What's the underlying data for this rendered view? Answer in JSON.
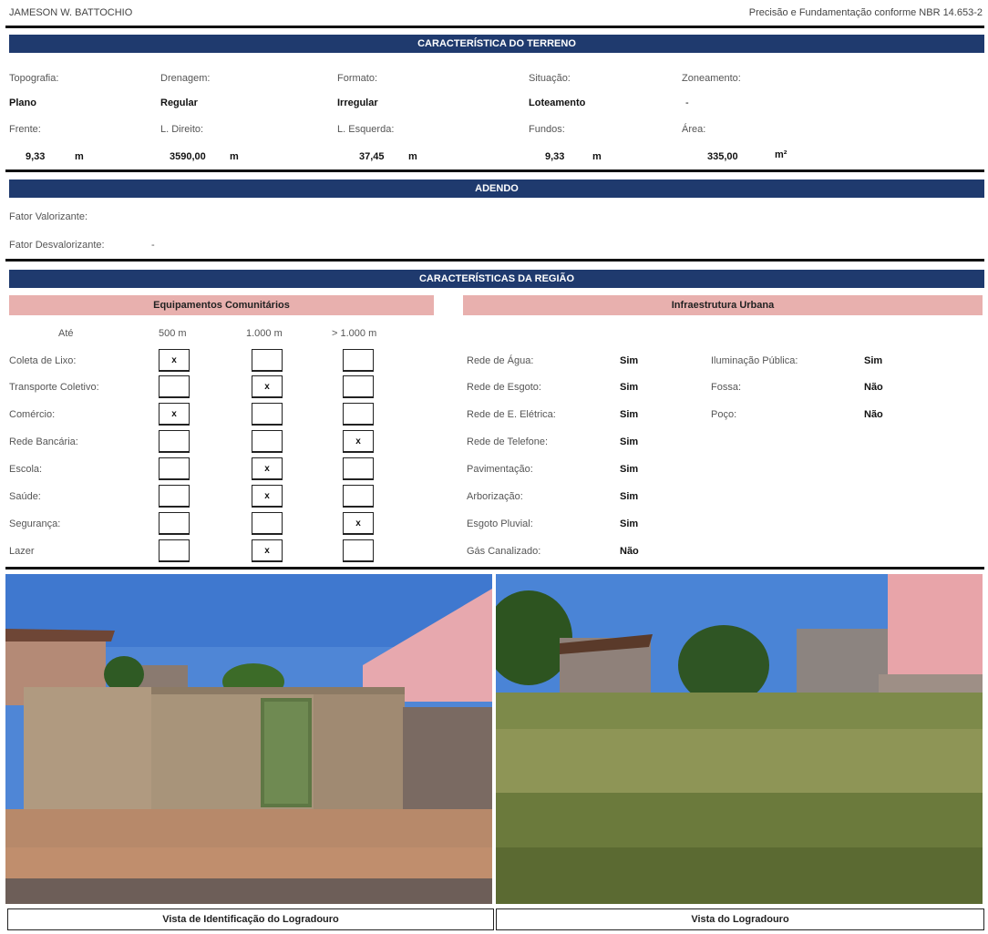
{
  "header": {
    "author": "JAMESON W. BATTOCHIO",
    "norm": "Precisão e Fundamentação conforme NBR 14.653-2"
  },
  "terreno": {
    "title": "CARACTERÍSTICA DO TERRENO",
    "topografia_label": "Topografia:",
    "topografia_value": "Plano",
    "drenagem_label": "Drenagem:",
    "drenagem_value": "Regular",
    "formato_label": "Formato:",
    "formato_value": "Irregular",
    "situacao_label": "Situação:",
    "situacao_value": "Loteamento",
    "zoneamento_label": "Zoneamento:",
    "zoneamento_value": "-",
    "frente_label": "Frente:",
    "frente_value": "9,33",
    "frente_unit": "m",
    "ldireito_label": "L. Direito:",
    "ldireito_value": "3590,00",
    "ldireito_unit": "m",
    "lesquerda_label": "L. Esquerda:",
    "lesquerda_value": "37,45",
    "lesquerda_unit": "m",
    "fundos_label": "Fundos:",
    "fundos_value": "9,33",
    "fundos_unit": "m",
    "area_label": "Área:",
    "area_value": "335,00",
    "area_unit": "m²"
  },
  "adendo": {
    "title": "ADENDO",
    "valorizante_label": "Fator Valorizante:",
    "desvalorizante_label": "Fator Desvalorizante:",
    "desvalorizante_value": "-"
  },
  "regiao": {
    "title": "CARACTERÍSTICAS DA REGIÃO",
    "equip_title": "Equipamentos Comunitários",
    "infra_title": "Infraestrutura Urbana",
    "col_ate": "Até",
    "col_500": "500 m",
    "col_1000": "1.000 m",
    "col_gt1000": "> 1.000 m",
    "equipamentos": [
      {
        "label": "Coleta de Lixo:",
        "marks": [
          "x",
          "",
          ""
        ]
      },
      {
        "label": "Transporte Coletivo:",
        "marks": [
          "",
          "x",
          ""
        ]
      },
      {
        "label": "Comércio:",
        "marks": [
          "x",
          "",
          ""
        ]
      },
      {
        "label": "Rede Bancária:",
        "marks": [
          "",
          "",
          "x"
        ]
      },
      {
        "label": "Escola:",
        "marks": [
          "",
          "x",
          ""
        ]
      },
      {
        "label": "Saúde:",
        "marks": [
          "",
          "x",
          ""
        ]
      },
      {
        "label": "Segurança:",
        "marks": [
          "",
          "",
          "x"
        ]
      },
      {
        "label": "Lazer",
        "marks": [
          "",
          "x",
          ""
        ]
      }
    ],
    "infra_left": [
      {
        "label": "Rede de Água:",
        "value": "Sim"
      },
      {
        "label": "Rede de Esgoto:",
        "value": "Sim"
      },
      {
        "label": "Rede de E. Elétrica:",
        "value": "Sim"
      },
      {
        "label": "Rede de Telefone:",
        "value": "Sim"
      },
      {
        "label": "Pavimentação:",
        "value": "Sim"
      },
      {
        "label": "Arborização:",
        "value": "Sim"
      },
      {
        "label": "Esgoto Pluvial:",
        "value": "Sim"
      },
      {
        "label": "Gás Canalizado:",
        "value": "Não"
      }
    ],
    "infra_right": [
      {
        "label": "Iluminação Pública:",
        "value": "Sim"
      },
      {
        "label": "Fossa:",
        "value": "Não"
      },
      {
        "label": "Poço:",
        "value": "Não"
      }
    ]
  },
  "photos": {
    "left_caption": "Vista de Identificação do Logradouro",
    "right_caption": "Vista do Logradouro"
  },
  "colors": {
    "band": "#1f3a6e",
    "pink": "#e8b0ae"
  }
}
